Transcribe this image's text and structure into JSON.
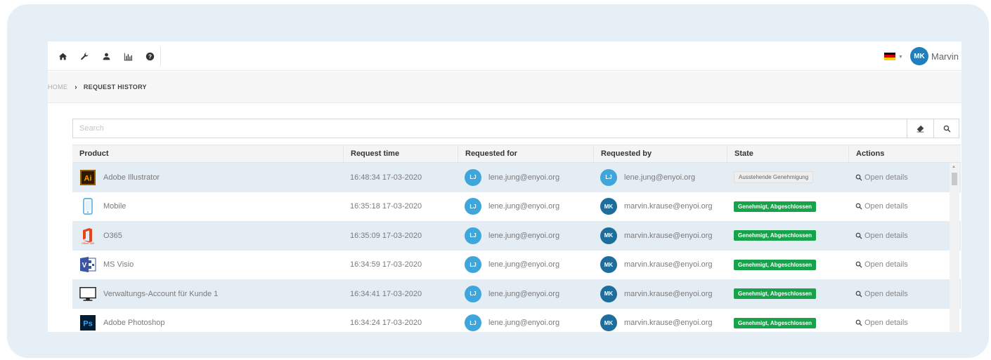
{
  "user": {
    "initials": "MK",
    "name": "Marvin"
  },
  "breadcrumb": {
    "home": "HOME",
    "current": "REQUEST HISTORY"
  },
  "search": {
    "placeholder": "Search"
  },
  "table": {
    "headers": [
      "Product",
      "Request time",
      "Requested for",
      "Requested by",
      "State",
      "Actions"
    ],
    "rows": [
      {
        "product": "Adobe Illustrator",
        "icon": "illustrator-icon",
        "time": "16:48:34 17-03-2020",
        "for_initials": "LJ",
        "for_email": "lene.jung@enyoi.org",
        "by_initials": "LJ",
        "by_email": "lene.jung@enyoi.org",
        "state": "Ausstehende Genehmigung",
        "state_kind": "pending",
        "action": "Open details"
      },
      {
        "product": "Mobile",
        "icon": "mobile-phone-icon",
        "time": "16:35:18 17-03-2020",
        "for_initials": "LJ",
        "for_email": "lene.jung@enyoi.org",
        "by_initials": "MK",
        "by_email": "marvin.krause@enyoi.org",
        "state": "Genehmigt, Abgeschlossen",
        "state_kind": "approved",
        "action": "Open details"
      },
      {
        "product": "O365",
        "icon": "office-icon",
        "time": "16:35:09 17-03-2020",
        "for_initials": "LJ",
        "for_email": "lene.jung@enyoi.org",
        "by_initials": "MK",
        "by_email": "marvin.krause@enyoi.org",
        "state": "Genehmigt, Abgeschlossen",
        "state_kind": "approved",
        "action": "Open details"
      },
      {
        "product": "MS Visio",
        "icon": "visio-icon",
        "time": "16:34:59 17-03-2020",
        "for_initials": "LJ",
        "for_email": "lene.jung@enyoi.org",
        "by_initials": "MK",
        "by_email": "marvin.krause@enyoi.org",
        "state": "Genehmigt, Abgeschlossen",
        "state_kind": "approved",
        "action": "Open details"
      },
      {
        "product": "Verwaltungs-Account für Kunde 1",
        "icon": "monitor-icon",
        "time": "16:34:41 17-03-2020",
        "for_initials": "LJ",
        "for_email": "lene.jung@enyoi.org",
        "by_initials": "MK",
        "by_email": "marvin.krause@enyoi.org",
        "state": "Genehmigt, Abgeschlossen",
        "state_kind": "approved",
        "action": "Open details"
      },
      {
        "product": "Adobe Photoshop",
        "icon": "photoshop-icon",
        "time": "16:34:24 17-03-2020",
        "for_initials": "LJ",
        "for_email": "lene.jung@enyoi.org",
        "by_initials": "MK",
        "by_email": "marvin.krause@enyoi.org",
        "state": "Genehmigt, Abgeschlossen",
        "state_kind": "approved",
        "action": "Open details"
      }
    ]
  },
  "colors": {
    "accent": "#1f7fbd",
    "approved": "#16a34a",
    "row_alt": "#e4ecf4",
    "frame": "#e6eff6"
  }
}
